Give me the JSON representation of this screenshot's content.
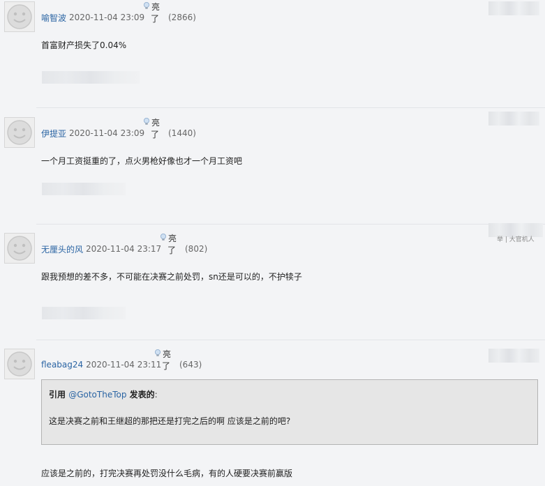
{
  "posts": [
    {
      "username": "喻智波",
      "datetime": "2020-11-04 23:09",
      "like_label_top": "亮",
      "like_label_bottom": "了",
      "like_count": "(2866)",
      "body": "首富财产损失了0.04%"
    },
    {
      "username": "伊提亚",
      "datetime": "2020-11-04 23:09",
      "like_label_top": "亮",
      "like_label_bottom": "了",
      "like_count": "(1440)",
      "body": "一个月工资挺重的了，点火男枪好像也才一个月工资吧"
    },
    {
      "username": "无厘头的风",
      "datetime": "2020-11-04 23:17",
      "like_label_top": "亮",
      "like_label_bottom": "了",
      "like_count": "(802)",
      "body": "跟我预想的差不多，不可能在决赛之前处罚，sn还是可以的，不护犊子",
      "corner_fragment": "举 | 大官机人"
    },
    {
      "username": "fleabag24",
      "datetime": "2020-11-04 23:11",
      "like_label_top": "亮",
      "like_label_bottom": "了",
      "like_count": "(643)",
      "quote": {
        "prefix": "引用",
        "author": "@GotoTheTop",
        "suffix": "发表的",
        "colon": ":",
        "text": "这是决赛之前和王继超的那把还是打完之后的啊 应该是之前的吧?"
      },
      "body": "应该是之前的，打完决赛再处罚没什么毛病，有的人硬要决赛前赢版"
    }
  ],
  "icons": {
    "avatar": "default-avatar-icon",
    "like": "lightbulb-icon"
  },
  "colors": {
    "username": "#2a64a3",
    "background": "#f3f4f6",
    "quote_background": "#e6e6e6"
  }
}
